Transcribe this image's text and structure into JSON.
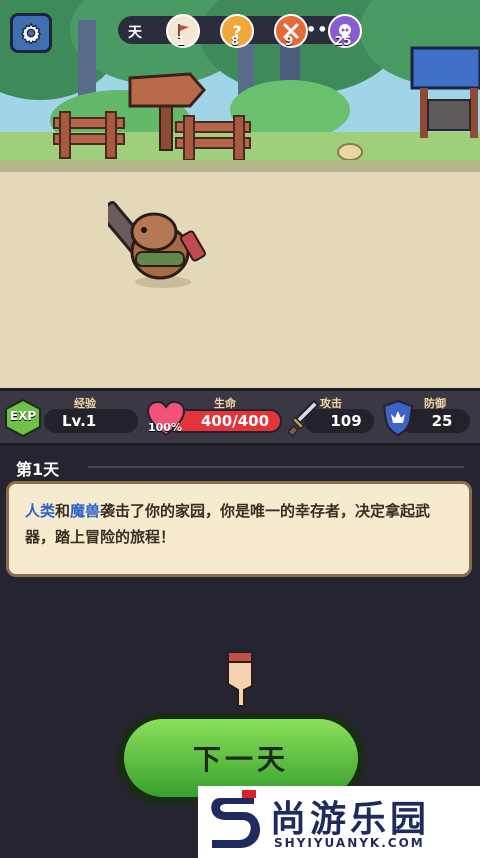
{
  "hud": {
    "settings_icon": "gear-icon",
    "day_label": "天",
    "nodes": [
      {
        "icon": "flag-icon",
        "num": "1",
        "color": "#f3e8d2"
      },
      {
        "icon": "question-icon",
        "num": "8",
        "color": "#f2a73a"
      },
      {
        "icon": "crossed-swords-icon",
        "num": "9",
        "color": "#e36b3a"
      },
      {
        "icon": "skull-icon",
        "num": "25",
        "color": "#8a5bd1"
      }
    ],
    "dots": "•••"
  },
  "stats": {
    "exp": {
      "badge": "EXP",
      "caption": "经验",
      "value": "Lv.1"
    },
    "hp": {
      "caption": "生命",
      "value": "400/400",
      "percent": "100%",
      "level": 1.0
    },
    "attack": {
      "caption": "攻击",
      "value": "109"
    },
    "defense": {
      "caption": "防御",
      "value": "25"
    }
  },
  "log": {
    "day_title": "第1天",
    "message_parts": {
      "a": "人类",
      "b": "和",
      "c": "魔兽",
      "d": "袭击了你的家园，你是唯一的幸存者，决定拿起武器，踏上冒险的旅程！"
    }
  },
  "next_button": {
    "label": "下一天"
  },
  "watermark": {
    "title": "尚游乐园",
    "url": "SHYIYUANYK.COM"
  },
  "colors": {
    "accent_green": "#4fbe36",
    "hp_red": "#e3343b",
    "shield_blue": "#3d63c9"
  }
}
